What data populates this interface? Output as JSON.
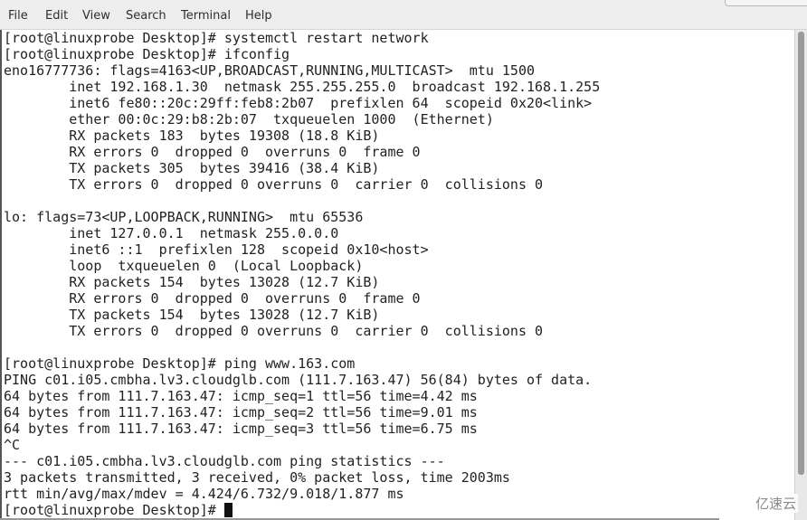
{
  "menu": [
    "File",
    "Edit",
    "View",
    "Search",
    "Terminal",
    "Help"
  ],
  "terminal": {
    "lines": [
      "[root@linuxprobe Desktop]# systemctl restart network",
      "[root@linuxprobe Desktop]# ifconfig",
      "eno16777736: flags=4163<UP,BROADCAST,RUNNING,MULTICAST>  mtu 1500",
      "        inet 192.168.1.30  netmask 255.255.255.0  broadcast 192.168.1.255",
      "        inet6 fe80::20c:29ff:feb8:2b07  prefixlen 64  scopeid 0x20<link>",
      "        ether 00:0c:29:b8:2b:07  txqueuelen 1000  (Ethernet)",
      "        RX packets 183  bytes 19308 (18.8 KiB)",
      "        RX errors 0  dropped 0  overruns 0  frame 0",
      "        TX packets 305  bytes 39416 (38.4 KiB)",
      "        TX errors 0  dropped 0 overruns 0  carrier 0  collisions 0",
      "",
      "lo: flags=73<UP,LOOPBACK,RUNNING>  mtu 65536",
      "        inet 127.0.0.1  netmask 255.0.0.0",
      "        inet6 ::1  prefixlen 128  scopeid 0x10<host>",
      "        loop  txqueuelen 0  (Local Loopback)",
      "        RX packets 154  bytes 13028 (12.7 KiB)",
      "        RX errors 0  dropped 0  overruns 0  frame 0",
      "        TX packets 154  bytes 13028 (12.7 KiB)",
      "        TX errors 0  dropped 0 overruns 0  carrier 0  collisions 0",
      "",
      "[root@linuxprobe Desktop]# ping www.163.com",
      "PING c01.i05.cmbha.lv3.cloudglb.com (111.7.163.47) 56(84) bytes of data.",
      "64 bytes from 111.7.163.47: icmp_seq=1 ttl=56 time=4.42 ms",
      "64 bytes from 111.7.163.47: icmp_seq=2 ttl=56 time=9.01 ms",
      "64 bytes from 111.7.163.47: icmp_seq=3 ttl=56 time=6.75 ms",
      "^C",
      "--- c01.i05.cmbha.lv3.cloudglb.com ping statistics ---",
      "3 packets transmitted, 3 received, 0% packet loss, time 2003ms",
      "rtt min/avg/max/mdev = 4.424/6.732/9.018/1.877 ms"
    ],
    "prompt": "[root@linuxprobe Desktop]# "
  },
  "watermark": "亿速云"
}
